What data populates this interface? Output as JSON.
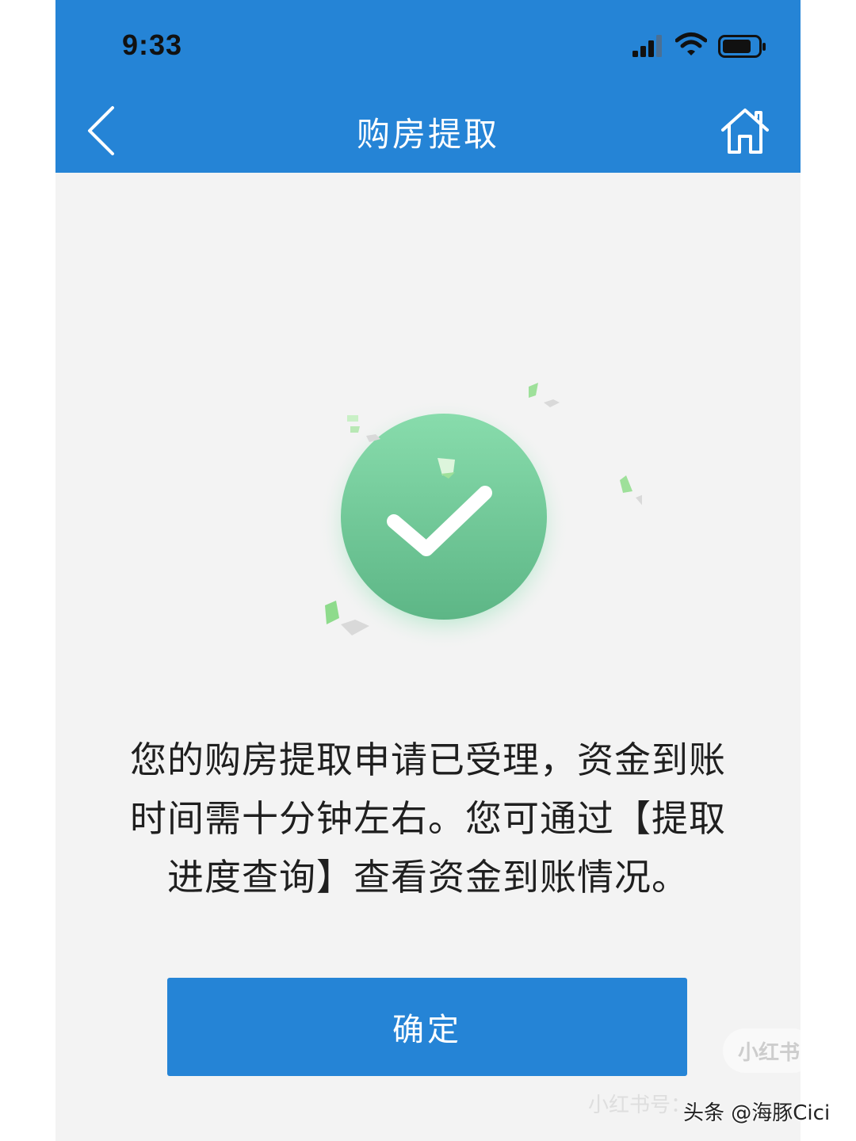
{
  "status_bar": {
    "time": "9:33"
  },
  "nav": {
    "title": "购房提取"
  },
  "result": {
    "message_lines": [
      "您的购房提取申请已受理，资金到账",
      "时间需十分钟左右。您可通过【提取",
      "进度查询】查看资金到账情况。"
    ]
  },
  "actions": {
    "confirm_label": "确定"
  },
  "watermark": {
    "badge": "小红书",
    "id_text": "小红书号：",
    "credit": "头条 @海豚Cici"
  },
  "colors": {
    "brand_blue": "#2584d6",
    "success_green": "#6fc496",
    "page_bg": "#f3f3f3"
  },
  "icons": {
    "back": "chevron-left-icon",
    "home": "home-icon",
    "success": "checkmark-icon"
  }
}
